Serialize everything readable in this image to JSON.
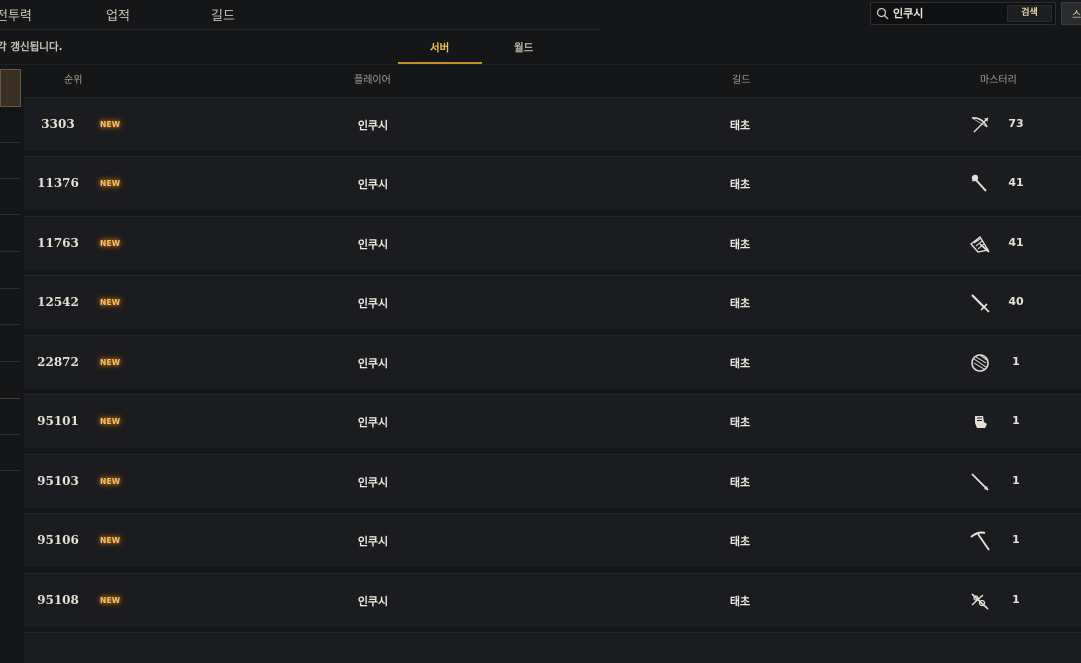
{
  "nav": {
    "items": [
      "전투력",
      "업적",
      "길드"
    ]
  },
  "search": {
    "value": "인쿠시",
    "button_label": "검색",
    "icon": "search-icon"
  },
  "corner_button_label": "스",
  "notice": "각 갱신됩니다.",
  "tabs": [
    {
      "label": "서버",
      "active": true
    },
    {
      "label": "월드",
      "active": false
    }
  ],
  "table": {
    "headers": {
      "rank": "순위",
      "player": "플레이어",
      "guild": "길드",
      "mastery": "마스터리"
    },
    "rows": [
      {
        "rank": "3303",
        "badge": "NEW",
        "player": "인쿠시",
        "guild": "태초",
        "mastery_icon": "bow-icon",
        "mastery": "73"
      },
      {
        "rank": "11376",
        "badge": "NEW",
        "player": "인쿠시",
        "guild": "태초",
        "mastery_icon": "staff-icon",
        "mastery": "41"
      },
      {
        "rank": "11763",
        "badge": "NEW",
        "player": "인쿠시",
        "guild": "태초",
        "mastery_icon": "crossbow-icon",
        "mastery": "41"
      },
      {
        "rank": "12542",
        "badge": "NEW",
        "player": "인쿠시",
        "guild": "태초",
        "mastery_icon": "sword-icon",
        "mastery": "40"
      },
      {
        "rank": "22872",
        "badge": "NEW",
        "player": "인쿠시",
        "guild": "태초",
        "mastery_icon": "shield-icon",
        "mastery": "1"
      },
      {
        "rank": "95101",
        "badge": "NEW",
        "player": "인쿠시",
        "guild": "태초",
        "mastery_icon": "gauntlet-icon",
        "mastery": "1"
      },
      {
        "rank": "95103",
        "badge": "NEW",
        "player": "인쿠시",
        "guild": "태초",
        "mastery_icon": "spear-icon",
        "mastery": "1"
      },
      {
        "rank": "95106",
        "badge": "NEW",
        "player": "인쿠시",
        "guild": "태초",
        "mastery_icon": "pickaxe-icon",
        "mastery": "1"
      },
      {
        "rank": "95108",
        "badge": "NEW",
        "player": "인쿠시",
        "guild": "태초",
        "mastery_icon": "tool-icon",
        "mastery": "1"
      }
    ]
  },
  "colors": {
    "background": "#151618",
    "row": "#1b1c1f",
    "accent": "#c98d2a",
    "badge": "#f3c26a",
    "search_button_text": "#e8d9a8"
  }
}
